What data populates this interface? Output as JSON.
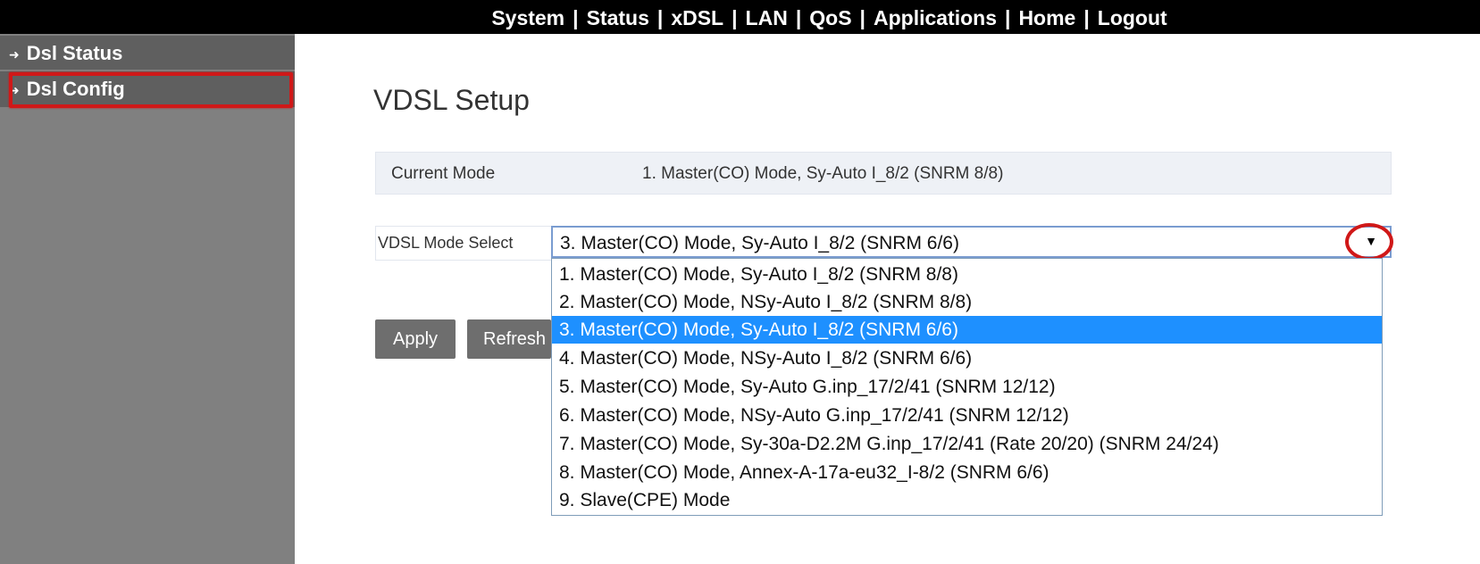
{
  "topnav": {
    "items": [
      "System",
      "Status",
      "xDSL",
      "LAN",
      "QoS",
      "Applications",
      "Home",
      "Logout"
    ],
    "separator": "|"
  },
  "sidebar": {
    "arrow_icon": "right-arrow-icon",
    "items": [
      {
        "label": "Dsl Status"
      },
      {
        "label": "Dsl Config",
        "highlighted": true
      }
    ]
  },
  "main": {
    "title": "VDSL Setup",
    "current_mode": {
      "label": "Current Mode",
      "value": "1. Master(CO) Mode, Sy-Auto I_8/2 (SNRM 8/8)"
    },
    "mode_select": {
      "label": "VDSL Mode Select",
      "value": "3. Master(CO) Mode, Sy-Auto I_8/2 (SNRM 6/6)",
      "expanded": true,
      "options": [
        "1. Master(CO) Mode, Sy-Auto I_8/2 (SNRM 8/8)",
        "2. Master(CO) Mode, NSy-Auto I_8/2 (SNRM 8/8)",
        "3. Master(CO) Mode, Sy-Auto I_8/2 (SNRM 6/6)",
        "4. Master(CO) Mode, NSy-Auto I_8/2 (SNRM 6/6)",
        "5. Master(CO) Mode, Sy-Auto G.inp_17/2/41 (SNRM 12/12)",
        "6. Master(CO) Mode, NSy-Auto G.inp_17/2/41 (SNRM 12/12)",
        "7. Master(CO) Mode, Sy-30a-D2.2M G.inp_17/2/41 (Rate 20/20) (SNRM 24/24)",
        "8. Master(CO) Mode, Annex-A-17a-eu32_I-8/2 (SNRM 6/6)",
        "9. Slave(CPE) Mode"
      ],
      "selected_index": 2
    },
    "buttons": {
      "apply": "Apply",
      "refresh": "Refresh"
    }
  },
  "colors": {
    "topbar": "#000000",
    "sidebar": "#808080",
    "highlight": "#d01818",
    "selected_option": "#1e90ff"
  }
}
